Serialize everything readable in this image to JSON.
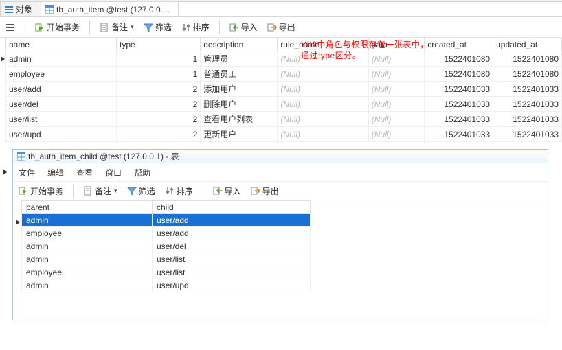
{
  "tabs": {
    "obj": "对象",
    "tbl": "tb_auth_item @test (127.0.0...."
  },
  "toolbar": {
    "begin_tx": "开始事务",
    "memo": "备注",
    "filter": "筛选",
    "sort": "排序",
    "import": "导入",
    "export": "导出"
  },
  "annotation_l1": "YII2中角色与权限存在一张表中，",
  "annotation_l2": "通过type区分。",
  "grid": {
    "headers": {
      "name": "name",
      "type": "type",
      "description": "description",
      "rule_name": "rule_name",
      "data": "data",
      "created_at": "created_at",
      "updated_at": "updated_at"
    },
    "null_text": "(Null)",
    "rows": [
      {
        "name": "admin",
        "type": "1",
        "description": "管理员",
        "rule_name": null,
        "data": null,
        "created_at": "1522401080",
        "updated_at": "1522401080",
        "current": true
      },
      {
        "name": "employee",
        "type": "1",
        "description": "普通员工",
        "rule_name": null,
        "data": null,
        "created_at": "1522401080",
        "updated_at": "1522401080"
      },
      {
        "name": "user/add",
        "type": "2",
        "description": "添加用户",
        "rule_name": null,
        "data": null,
        "created_at": "1522401033",
        "updated_at": "1522401033"
      },
      {
        "name": "user/del",
        "type": "2",
        "description": "删除用户",
        "rule_name": null,
        "data": null,
        "created_at": "1522401033",
        "updated_at": "1522401033"
      },
      {
        "name": "user/list",
        "type": "2",
        "description": "查看用户列表",
        "rule_name": null,
        "data": null,
        "created_at": "1522401033",
        "updated_at": "1522401033"
      },
      {
        "name": "user/upd",
        "type": "2",
        "description": "更新用户",
        "rule_name": null,
        "data": null,
        "created_at": "1522401033",
        "updated_at": "1522401033"
      }
    ]
  },
  "child": {
    "title": "tb_auth_item_child @test (127.0.0.1) - 表",
    "menu": {
      "file": "文件",
      "edit": "编辑",
      "view": "查看",
      "window": "窗口",
      "help": "帮助"
    },
    "headers": {
      "parent": "parent",
      "child": "child"
    },
    "rows": [
      {
        "parent": "admin",
        "child": "user/add",
        "selected": true,
        "current": true
      },
      {
        "parent": "employee",
        "child": "user/add"
      },
      {
        "parent": "admin",
        "child": "user/del"
      },
      {
        "parent": "admin",
        "child": "user/list"
      },
      {
        "parent": "employee",
        "child": "user/list"
      },
      {
        "parent": "admin",
        "child": "user/upd"
      }
    ]
  }
}
